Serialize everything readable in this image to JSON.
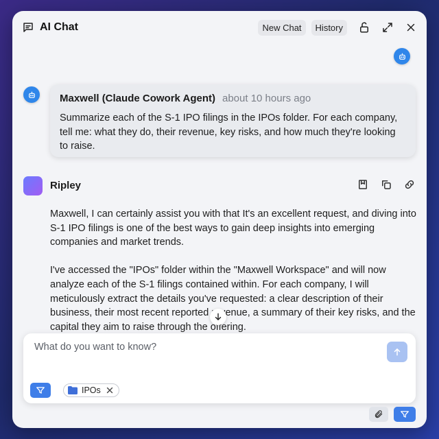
{
  "window": {
    "title": "AI Chat",
    "buttons": {
      "new_chat": "New Chat",
      "history": "History"
    },
    "icons": [
      "chat-icon",
      "unlock-icon",
      "expand-icon",
      "close-icon"
    ]
  },
  "messages": [
    {
      "author": "Maxwell (Claude Cowork Agent)",
      "time": "about 10 hours ago",
      "text": "Summarize each of the S-1 IPO filings in the IPOs folder. For each company, tell me: what they do, their revenue, key risks, and how much they're looking to raise."
    },
    {
      "author": "Ripley",
      "paragraphs": [
        "Maxwell, I can certainly assist you with that It's an excellent request, and diving into S-1 IPO filings is one of the best ways to gain deep insights into emerging companies and market trends.",
        "I've accessed the \"IPOs\" folder within the \"Maxwell Workspace\" and will now analyze each of the S-1 filings contained within. For each company, I will meticulously extract the details you've requested: a clear description of their business, their most recent reported revenue, a summary of their key risks, and the capital they aim to raise through the offering."
      ]
    }
  ],
  "composer": {
    "placeholder": "What do you want to know?",
    "chip_label": "IPOs"
  },
  "colors": {
    "accent": "#3f7ee8",
    "agent_avatar": "#2f86ea",
    "send_disabled": "#a9c2f2"
  }
}
